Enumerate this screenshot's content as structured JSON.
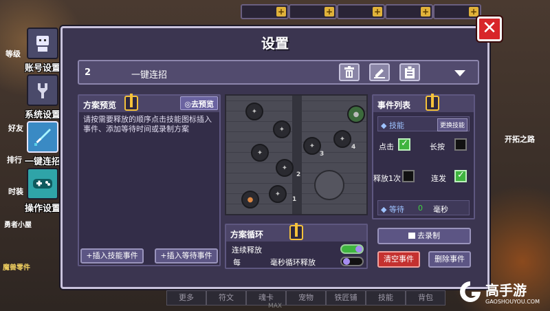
{
  "dialog": {
    "title": "设置",
    "close_glyph": "✕"
  },
  "side_tabs": [
    {
      "label": "账号设置",
      "icon": "account-icon",
      "active": false
    },
    {
      "label": "系统设置",
      "icon": "wrench-icon",
      "active": false
    },
    {
      "label": "一键连招",
      "icon": "sword-icon",
      "active": true
    },
    {
      "label": "操作设置",
      "icon": "gamepad-icon",
      "active": false
    }
  ],
  "preset": {
    "number": "2",
    "name": "一键连招"
  },
  "preview": {
    "header": "方案预览",
    "preview_button": "◎去预览",
    "description": "请按需要释放的顺序点击技能图标插入事件、添加等待时间或录制方案",
    "insert_skill_button": "+插入技能事件",
    "insert_wait_button": "+插入等待事件"
  },
  "map": {
    "nodes": [
      "",
      "",
      "",
      "",
      "",
      "",
      "",
      "",
      "",
      "",
      ""
    ],
    "numbers": [
      "1",
      "2",
      "3",
      "4"
    ]
  },
  "loop": {
    "header": "方案循环",
    "continuous_label": "连续释放",
    "continuous_on": true,
    "every_label": "每",
    "interval_label": "毫秒循环释放",
    "interval_on": false
  },
  "events": {
    "header": "事件列表",
    "skill_label": "◆ 技能",
    "change_skill_button": "更换技能",
    "click_label": "点击",
    "click_checked": true,
    "long_press_label": "长按",
    "long_press_checked": false,
    "release_once_label": "释放1次",
    "release_once_checked": false,
    "rapid_fire_label": "连发",
    "rapid_fire_checked": true,
    "wait_label": "◆ 等待",
    "wait_value": "0",
    "wait_unit": "毫秒",
    "record_button": "去录制",
    "clear_button": "清空事件",
    "delete_button": "删除事件"
  },
  "bottom_tabs": [
    "更多",
    "符文",
    "魂卡",
    "宠物",
    "铁匠铺",
    "技能",
    "背包"
  ],
  "bottom_note": "MAX",
  "background_labels": [
    "等级",
    "好友",
    "排行",
    "时装",
    "勇者小屋",
    "魔兽零件",
    "开拓之路"
  ],
  "watermark": {
    "name": "高手游",
    "url": "GAOSHOUYOU.COM"
  },
  "colors": {
    "dialog_bg": "#3b3550",
    "accent_yellow": "#f5c23a",
    "close_red": "#d8262a",
    "button_red": "#c4312f",
    "check_green": "#3fb43f",
    "tab_active": "#3a8ac4"
  }
}
